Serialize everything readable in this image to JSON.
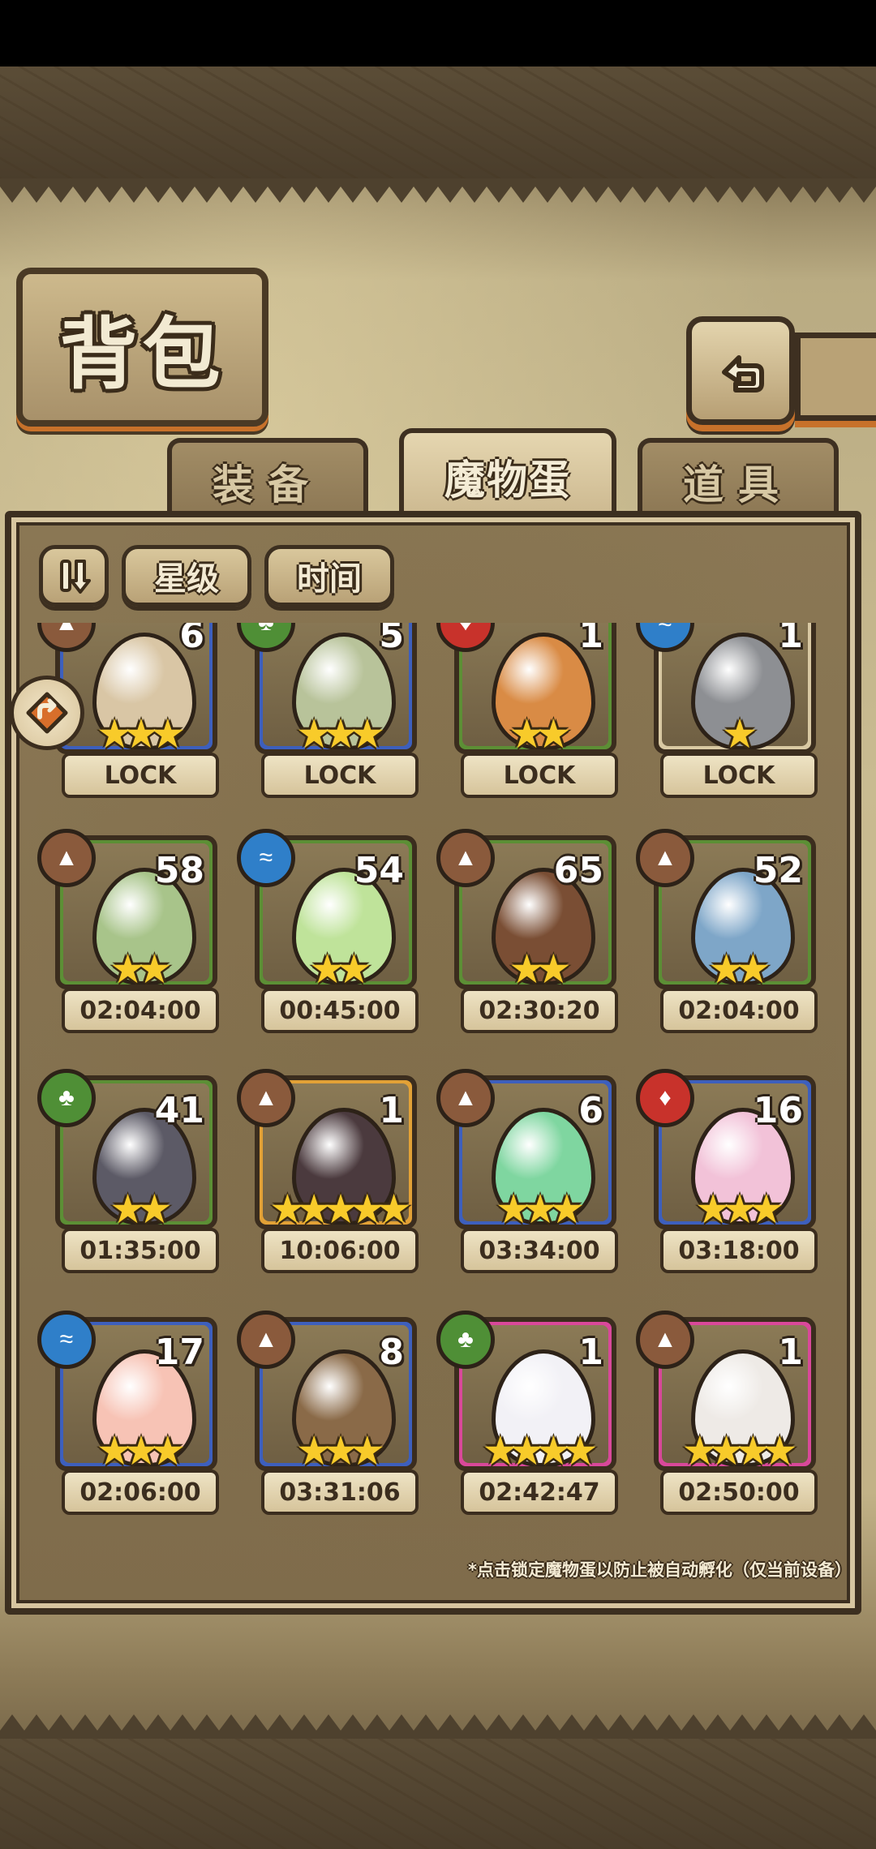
{
  "title": "背包",
  "tabs": [
    {
      "label": "装备",
      "active": false
    },
    {
      "label": "魔物蛋",
      "active": true
    },
    {
      "label": "道具",
      "active": false
    }
  ],
  "sort": {
    "order_icon": "sort-order-icon",
    "buttons": [
      "星级",
      "时间"
    ]
  },
  "eggs": [
    {
      "count": "6",
      "stars": 3,
      "frame": "#3d5fbd",
      "element": "earth",
      "status": "LOCK",
      "egg_color": "#d9c6a5"
    },
    {
      "count": "5",
      "stars": 3,
      "frame": "#3d5fbd",
      "element": "plant",
      "status": "LOCK",
      "egg_color": "#b8c39a"
    },
    {
      "count": "1",
      "stars": 2,
      "frame": "#5c8f35",
      "element": "fire",
      "status": "LOCK",
      "egg_color": "#d98b45"
    },
    {
      "count": "1",
      "stars": 1,
      "frame": "#d9c9a3",
      "element": "water",
      "status": "LOCK",
      "egg_color": "#8d8f93"
    },
    {
      "count": "58",
      "stars": 2,
      "frame": "#5c8f35",
      "element": "earth",
      "status": "02:04:00",
      "egg_color": "#a8c48a"
    },
    {
      "count": "54",
      "stars": 2,
      "frame": "#5c8f35",
      "element": "water",
      "status": "00:45:00",
      "egg_color": "#bfe39a"
    },
    {
      "count": "65",
      "stars": 2,
      "frame": "#5c8f35",
      "element": "earth",
      "status": "02:30:20",
      "egg_color": "#7a4e34"
    },
    {
      "count": "52",
      "stars": 2,
      "frame": "#5c8f35",
      "element": "earth",
      "status": "02:04:00",
      "egg_color": "#7ea6c8"
    },
    {
      "count": "41",
      "stars": 2,
      "frame": "#5c8f35",
      "element": "plant",
      "status": "01:35:00",
      "egg_color": "#5c5a66"
    },
    {
      "count": "1",
      "stars": 5,
      "frame": "#e2a136",
      "element": "earth",
      "status": "10:06:00",
      "egg_color": "#4b3a3e"
    },
    {
      "count": "6",
      "stars": 3,
      "frame": "#3d5fbd",
      "element": "earth",
      "status": "03:34:00",
      "egg_color": "#7fd6a0"
    },
    {
      "count": "16",
      "stars": 3,
      "frame": "#3d5fbd",
      "element": "fire",
      "status": "03:18:00",
      "egg_color": "#f2c2d8"
    },
    {
      "count": "17",
      "stars": 3,
      "frame": "#3d5fbd",
      "element": "water",
      "status": "02:06:00",
      "egg_color": "#f7c3b5"
    },
    {
      "count": "8",
      "stars": 3,
      "frame": "#3d5fbd",
      "element": "earth",
      "status": "03:31:06",
      "egg_color": "#8a6a48"
    },
    {
      "count": "1",
      "stars": 4,
      "frame": "#d9489a",
      "element": "plant",
      "status": "02:42:47",
      "egg_color": "#f2f1f6"
    },
    {
      "count": "1",
      "stars": 4,
      "frame": "#d9489a",
      "element": "earth",
      "status": "02:50:00",
      "egg_color": "#eeeae6"
    }
  ],
  "element_colors": {
    "earth": "#8a5a3c",
    "plant": "#4f8f36",
    "fire": "#c8322b",
    "water": "#2f7fc9"
  },
  "footnote": "*点击锁定魔物蛋以防止被自动孵化（仅当前设备）"
}
